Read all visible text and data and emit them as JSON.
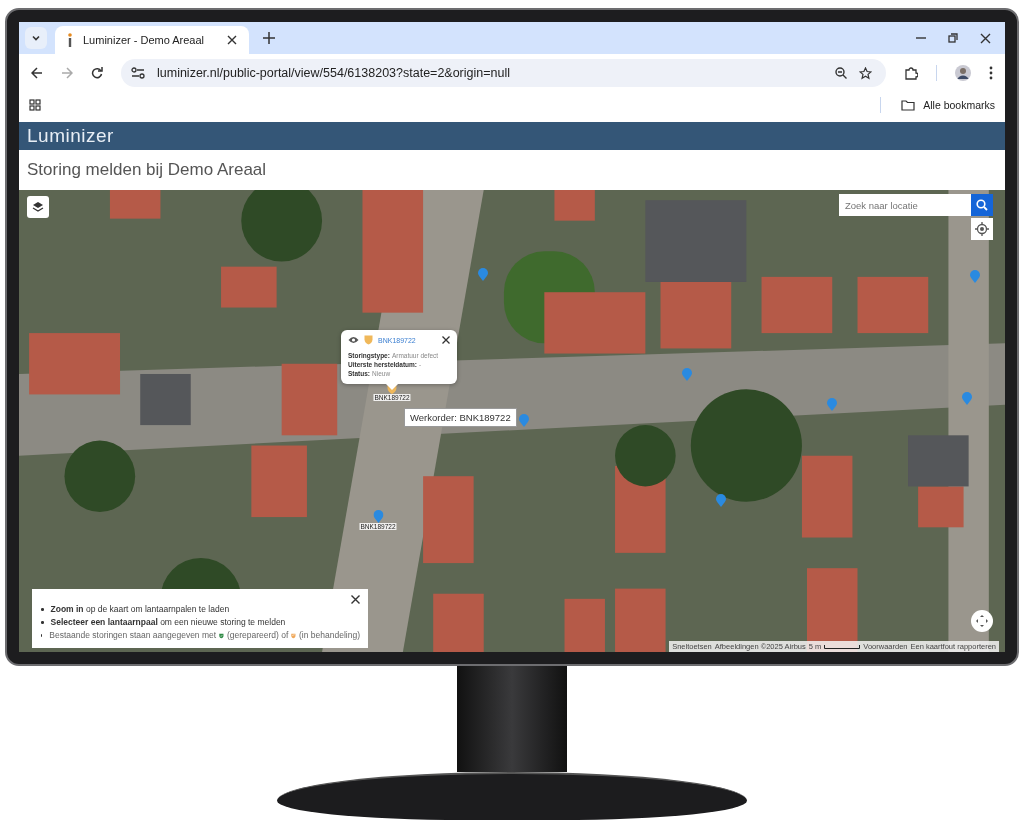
{
  "browser": {
    "tab_title": "Luminizer - Demo Areaal",
    "url": "luminizer.nl/public-portal/view/554/6138203?state=2&origin=null",
    "bookmarks_label": "Alle bookmarks"
  },
  "app": {
    "logo": "Luminizer",
    "page_title": "Storing melden bij Demo Areaal"
  },
  "map": {
    "search": {
      "placeholder": "Zoek naar locatie"
    },
    "popup": {
      "workorder": "BNK189722",
      "fields": [
        {
          "label": "Storingstype:",
          "value": "Armatuur defect"
        },
        {
          "label": "Uiterste hersteldatum:",
          "value": "-"
        },
        {
          "label": "Status:",
          "value": "Nieuw"
        }
      ]
    },
    "tooltip": "Werkorder: BNK189722",
    "markers": [
      {
        "kind": "fault",
        "label": "BNK189722"
      },
      {
        "kind": "pin"
      },
      {
        "kind": "pin"
      },
      {
        "kind": "pin"
      },
      {
        "kind": "pin"
      },
      {
        "kind": "pin"
      },
      {
        "kind": "pin"
      },
      {
        "kind": "pin"
      },
      {
        "kind": "pin",
        "label": "BNK189722"
      }
    ],
    "info": {
      "items": [
        {
          "kind": "text",
          "text": "**Zoom in** op de kaart om lantaarnpalen te laden"
        },
        {
          "kind": "text",
          "text": "**Selecteer een lantaarnpaal** om een nieuwe storing te melden"
        },
        {
          "kind": "legend",
          "before": "Bestaande storingen staan aangegeven met",
          "repaired": "(gerepareerd) of",
          "in_progress": "(in behandeling)"
        }
      ]
    },
    "attribution": [
      "Sneltoetsen",
      "Afbeeldingen ©2025 Airbus",
      "5 m",
      "Voorwaarden",
      "Een kaartfout rapporteren"
    ]
  }
}
